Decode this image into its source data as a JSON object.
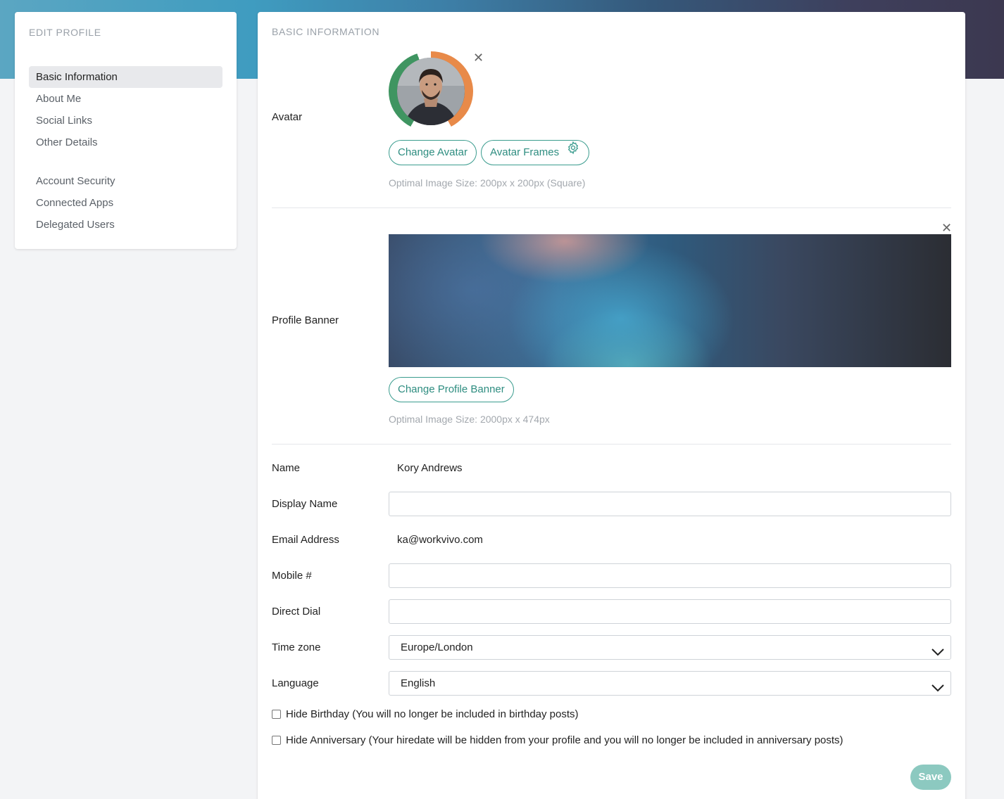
{
  "sidebar": {
    "title": "EDIT PROFILE",
    "items": [
      {
        "label": "Basic Information",
        "active": true
      },
      {
        "label": "About Me"
      },
      {
        "label": "Social Links"
      },
      {
        "label": "Other Details"
      },
      {
        "label": "Account Security"
      },
      {
        "label": "Connected Apps"
      },
      {
        "label": "Delegated Users"
      }
    ]
  },
  "main": {
    "section_title": "BASIC INFORMATION",
    "avatar": {
      "label": "Avatar",
      "change_button": "Change Avatar",
      "frames_button": "Avatar Frames",
      "hint": "Optimal Image Size: 200px x 200px (Square)",
      "remove_icon": "close-icon"
    },
    "banner": {
      "label": "Profile Banner",
      "change_button": "Change Profile Banner",
      "hint": "Optimal Image Size: 2000px x 474px",
      "remove_icon": "close-icon"
    },
    "fields": {
      "name_label": "Name",
      "name_value": "Kory Andrews",
      "display_name_label": "Display Name",
      "display_name_value": "",
      "email_label": "Email Address",
      "email_value": "ka@workvivo.com",
      "mobile_label": "Mobile #",
      "mobile_value": "",
      "direct_dial_label": "Direct Dial",
      "direct_dial_value": "",
      "timezone_label": "Time zone",
      "timezone_value": "Europe/London",
      "language_label": "Language",
      "language_value": "English"
    },
    "checkboxes": {
      "hide_birthday": "Hide Birthday (You will no longer be included in birthday posts)",
      "hide_anniversary": "Hide Anniversary (Your hiredate will be hidden from your profile and you will no longer be included in anniversary posts)"
    },
    "save_label": "Save"
  },
  "colors": {
    "accent": "#3a9c8e",
    "save_disabled": "#8cc9c0",
    "frame_left": "#3f9561",
    "frame_right": "#e88a49"
  }
}
